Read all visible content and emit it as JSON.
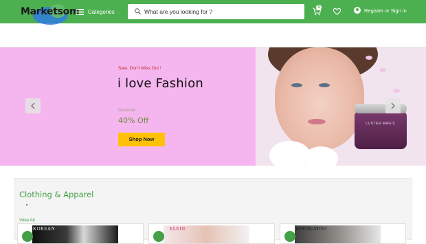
{
  "header": {
    "logo_text": "Marketsom",
    "categories_label": "Categories",
    "search_placeholder": "What are you looking for ?",
    "cart_count": "0",
    "account_label": "Register or Sign in"
  },
  "hero": {
    "tagline": "Sale, Don't Miss Out !",
    "title": "i love Fashion",
    "discount_label": "Discount",
    "discount_value": "40% Off",
    "shop_button": "Shop Now",
    "product_label": "LUSTER MAGIC"
  },
  "section": {
    "title": "Clothing & Apparel",
    "view_all": "View All",
    "cards": [
      {
        "caption": "KOREAN"
      },
      {
        "caption": "ELEIN"
      },
      {
        "caption": "AFFOGATOO"
      }
    ]
  },
  "colors": {
    "brand_green": "#4caf50",
    "hero_pink": "#f5b6ef",
    "shop_yellow": "#ffc107",
    "tagline_red": "#c62828"
  }
}
